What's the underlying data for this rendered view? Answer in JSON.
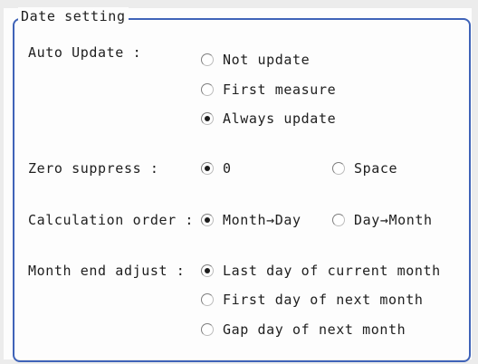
{
  "group_title": "Date setting",
  "auto_update": {
    "label": "Auto Update :",
    "options": [
      "Not update",
      "First measure",
      "Always update"
    ],
    "selected": "Always update"
  },
  "zero_suppress": {
    "label": "Zero suppress :",
    "options": [
      "0",
      "Space"
    ],
    "selected": "0"
  },
  "calculation_order": {
    "label": "Calculation order :",
    "options": [
      "Month→Day",
      "Day→Month"
    ],
    "selected": "Month→Day"
  },
  "month_end_adjust": {
    "label": "Month end adjust :",
    "options": [
      "Last day of current month",
      "First day of next month",
      "Gap day of next month"
    ],
    "selected": "Last day of current month"
  },
  "colors": {
    "frame": "#3f63b8",
    "panel": "#fdfdfd",
    "background": "#ececec"
  }
}
